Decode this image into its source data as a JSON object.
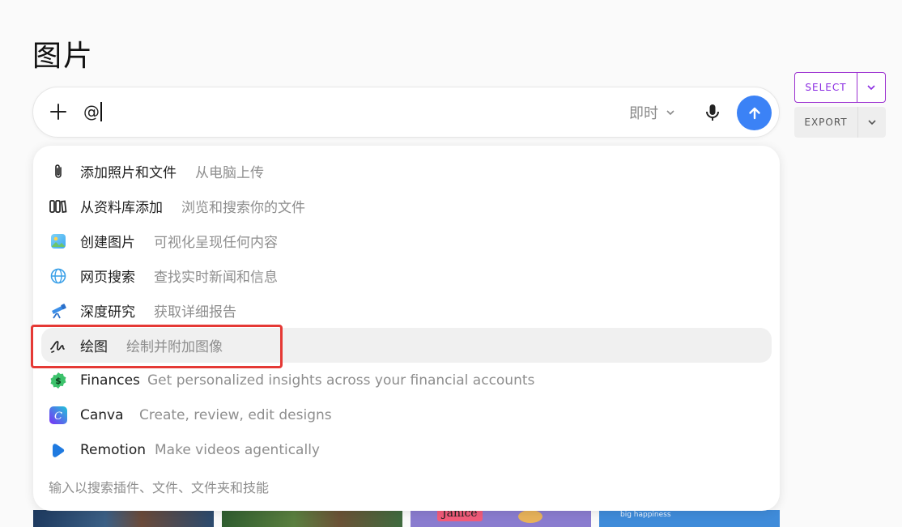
{
  "page": {
    "title": "图片"
  },
  "composer": {
    "input_value": "@",
    "mode_label": "即时"
  },
  "actions": {
    "select_label": "SELECT",
    "export_label": "EXPORT"
  },
  "menu": {
    "items": [
      {
        "label": "添加照片和文件",
        "description": "从电脑上传",
        "icon": "paperclip-icon"
      },
      {
        "label": "从资料库添加",
        "description": "浏览和搜索你的文件",
        "icon": "library-icon"
      },
      {
        "label": "创建图片",
        "description": "可视化呈现任何内容",
        "icon": "image-create-icon"
      },
      {
        "label": "网页搜索",
        "description": "查找实时新闻和信息",
        "icon": "globe-icon"
      },
      {
        "label": "深度研究",
        "description": "获取详细报告",
        "icon": "telescope-icon"
      },
      {
        "label": "绘图",
        "description": "绘制并附加图像",
        "icon": "draw-icon"
      },
      {
        "label": "Finances",
        "description": "Get personalized insights across your financial accounts",
        "icon": "finances-icon"
      },
      {
        "label": "Canva",
        "description": "Create, review, edit designs",
        "icon": "canva-icon"
      },
      {
        "label": "Remotion",
        "description": "Make videos agentically",
        "icon": "remotion-icon"
      }
    ],
    "search_hint": "输入以搜索插件、文件、文件夹和技能"
  },
  "tiles": {
    "tile3_label": "Janice",
    "tile4_text": "big happiness"
  },
  "colors": {
    "send": "#3b82f6",
    "select_accent": "#8a2be2",
    "highlight": "#e53935"
  }
}
